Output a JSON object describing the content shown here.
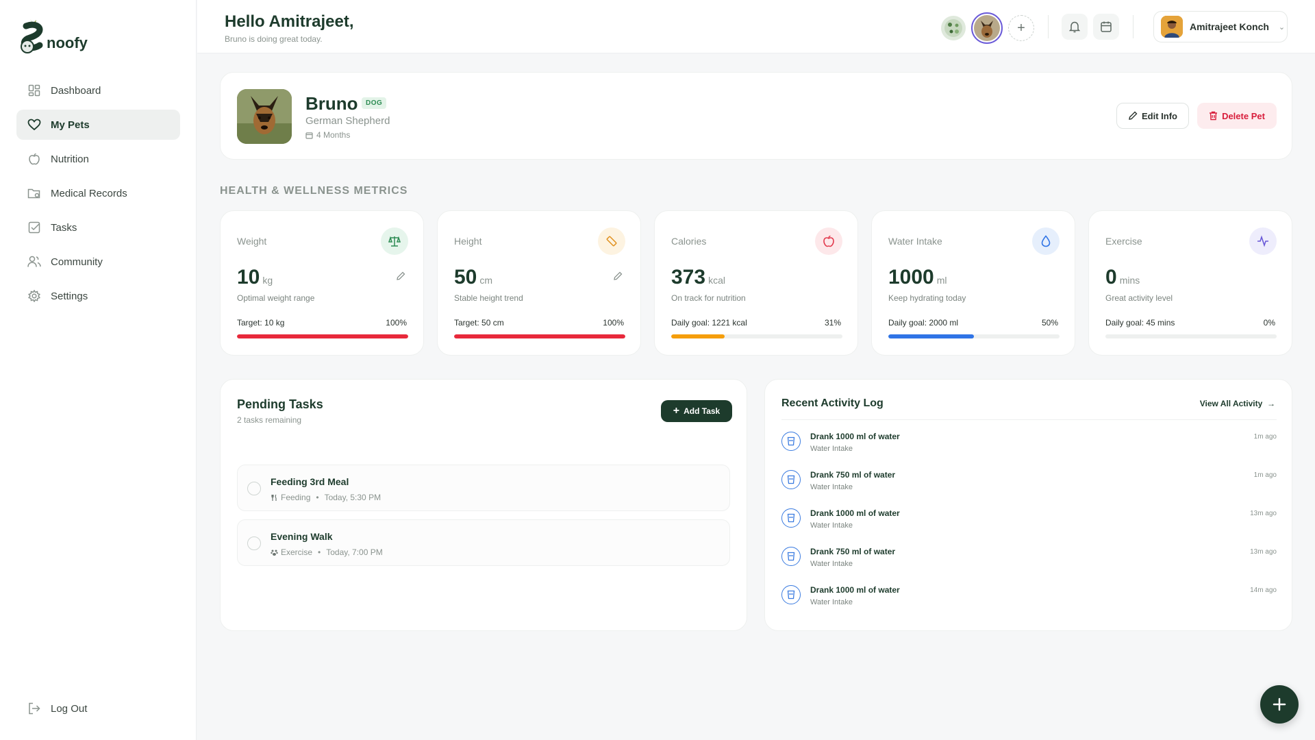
{
  "app": {
    "name": "noofy"
  },
  "sidebar": {
    "items": [
      {
        "label": "Dashboard",
        "icon": "grid-icon"
      },
      {
        "label": "My Pets",
        "icon": "heart-icon"
      },
      {
        "label": "Nutrition",
        "icon": "apple-icon"
      },
      {
        "label": "Medical Records",
        "icon": "folder-icon"
      },
      {
        "label": "Tasks",
        "icon": "checkbox-icon"
      },
      {
        "label": "Community",
        "icon": "users-icon"
      },
      {
        "label": "Settings",
        "icon": "gear-icon"
      }
    ],
    "active": "My Pets",
    "logout": "Log Out"
  },
  "header": {
    "greeting": "Hello Amitrajeet,",
    "subtitle": "Bruno is doing great today.",
    "user_name": "Amitrajeet Konch"
  },
  "pet": {
    "name": "Bruno",
    "type_badge": "DOG",
    "breed": "German Shepherd",
    "age": "4 Months",
    "edit_label": "Edit Info",
    "delete_label": "Delete Pet"
  },
  "metrics_title": "HEALTH & WELLNESS METRICS",
  "metrics": [
    {
      "label": "Weight",
      "value": "10",
      "unit": "kg",
      "sub": "Optimal weight range",
      "goal": "Target: 10 kg",
      "pct": "100%",
      "fraction": 1.0,
      "color": "#e8293b",
      "icon_bg": "#e6f5ec",
      "icon_color": "#2e8c54",
      "icon": "scale-icon",
      "editable": true
    },
    {
      "label": "Height",
      "value": "50",
      "unit": "cm",
      "sub": "Stable height trend",
      "goal": "Target: 50 cm",
      "pct": "100%",
      "fraction": 1.0,
      "color": "#e8293b",
      "icon_bg": "#fdf3e1",
      "icon_color": "#e0901e",
      "icon": "ruler-icon",
      "editable": true
    },
    {
      "label": "Calories",
      "value": "373",
      "unit": "kcal",
      "sub": "On track for nutrition",
      "goal": "Daily goal: 1221 kcal",
      "pct": "31%",
      "fraction": 0.31,
      "color": "#f59e0b",
      "icon_bg": "#fde8ea",
      "icon_color": "#e23b4e",
      "icon": "apple-icon",
      "editable": false
    },
    {
      "label": "Water Intake",
      "value": "1000",
      "unit": "ml",
      "sub": "Keep hydrating today",
      "goal": "Daily goal: 2000 ml",
      "pct": "50%",
      "fraction": 0.5,
      "color": "#2f74e6",
      "icon_bg": "#e6effc",
      "icon_color": "#2f74e6",
      "icon": "droplet-icon",
      "editable": false
    },
    {
      "label": "Exercise",
      "value": "0",
      "unit": "mins",
      "sub": "Great activity level",
      "goal": "Daily goal: 45 mins",
      "pct": "0%",
      "fraction": 0.0,
      "color": "#6a5ad8",
      "icon_bg": "#eeedfc",
      "icon_color": "#6a5ad8",
      "icon": "activity-icon",
      "editable": false
    }
  ],
  "tasks": {
    "title": "Pending Tasks",
    "remaining": "2 tasks remaining",
    "add_label": "Add Task",
    "items": [
      {
        "title": "Feeding 3rd Meal",
        "category": "Feeding",
        "time": "Today, 5:30 PM",
        "icon": "utensils-icon"
      },
      {
        "title": "Evening Walk",
        "category": "Exercise",
        "time": "Today, 7:00 PM",
        "icon": "paw-icon"
      }
    ]
  },
  "activity": {
    "title": "Recent Activity Log",
    "view_all": "View All Activity",
    "items": [
      {
        "title": "Drank 1000 ml of water",
        "sub": "Water Intake",
        "time": "1m ago"
      },
      {
        "title": "Drank 750 ml of water",
        "sub": "Water Intake",
        "time": "1m ago"
      },
      {
        "title": "Drank 1000 ml of water",
        "sub": "Water Intake",
        "time": "13m ago"
      },
      {
        "title": "Drank 750 ml of water",
        "sub": "Water Intake",
        "time": "13m ago"
      },
      {
        "title": "Drank 1000 ml of water",
        "sub": "Water Intake",
        "time": "14m ago"
      }
    ]
  }
}
